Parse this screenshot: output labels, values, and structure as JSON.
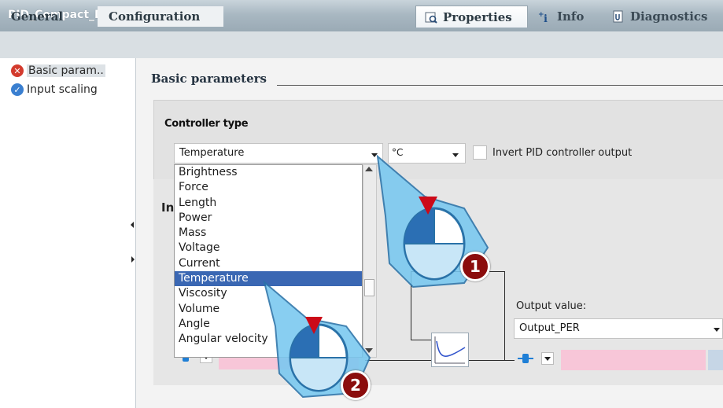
{
  "window": {
    "title": "PID_Compact_DB"
  },
  "inspector_tabs": [
    {
      "label": "Properties",
      "icon": "properties-icon"
    },
    {
      "label": "Info",
      "icon": "info-icon"
    },
    {
      "label": "Diagnostics",
      "icon": "diagnostics-icon"
    }
  ],
  "sub_tabs": [
    {
      "label": "General"
    },
    {
      "label": "Configuration"
    }
  ],
  "nav": {
    "items": [
      {
        "label": "Basic param..",
        "status": "error"
      },
      {
        "label": "Input scaling",
        "status": "ok"
      }
    ]
  },
  "main": {
    "section_title": "Basic parameters",
    "controller_type": {
      "heading": "Controller type",
      "selected": "Temperature",
      "unit": "°C",
      "invert_label": "Invert PID controller output",
      "invert_checked": false,
      "options": [
        "Brightness",
        "Force",
        "Length",
        "Power",
        "Mass",
        "Voltage",
        "Current",
        "Temperature",
        "Viscosity",
        "Volume",
        "Angle",
        "Angular velocity"
      ],
      "highlighted_option": "Temperature"
    },
    "panel2_heading": "In",
    "output": {
      "label": "Output value:",
      "selected": "Output_PER"
    }
  },
  "callouts": [
    {
      "number": "1"
    },
    {
      "number": "2"
    }
  ],
  "colors": {
    "accent_selection": "#3a67b3",
    "error_badge": "#d33b2e",
    "ok_badge": "#3a7fd0",
    "callout_badge": "#8b0d0d",
    "field_pink": "#f7c6d8"
  }
}
